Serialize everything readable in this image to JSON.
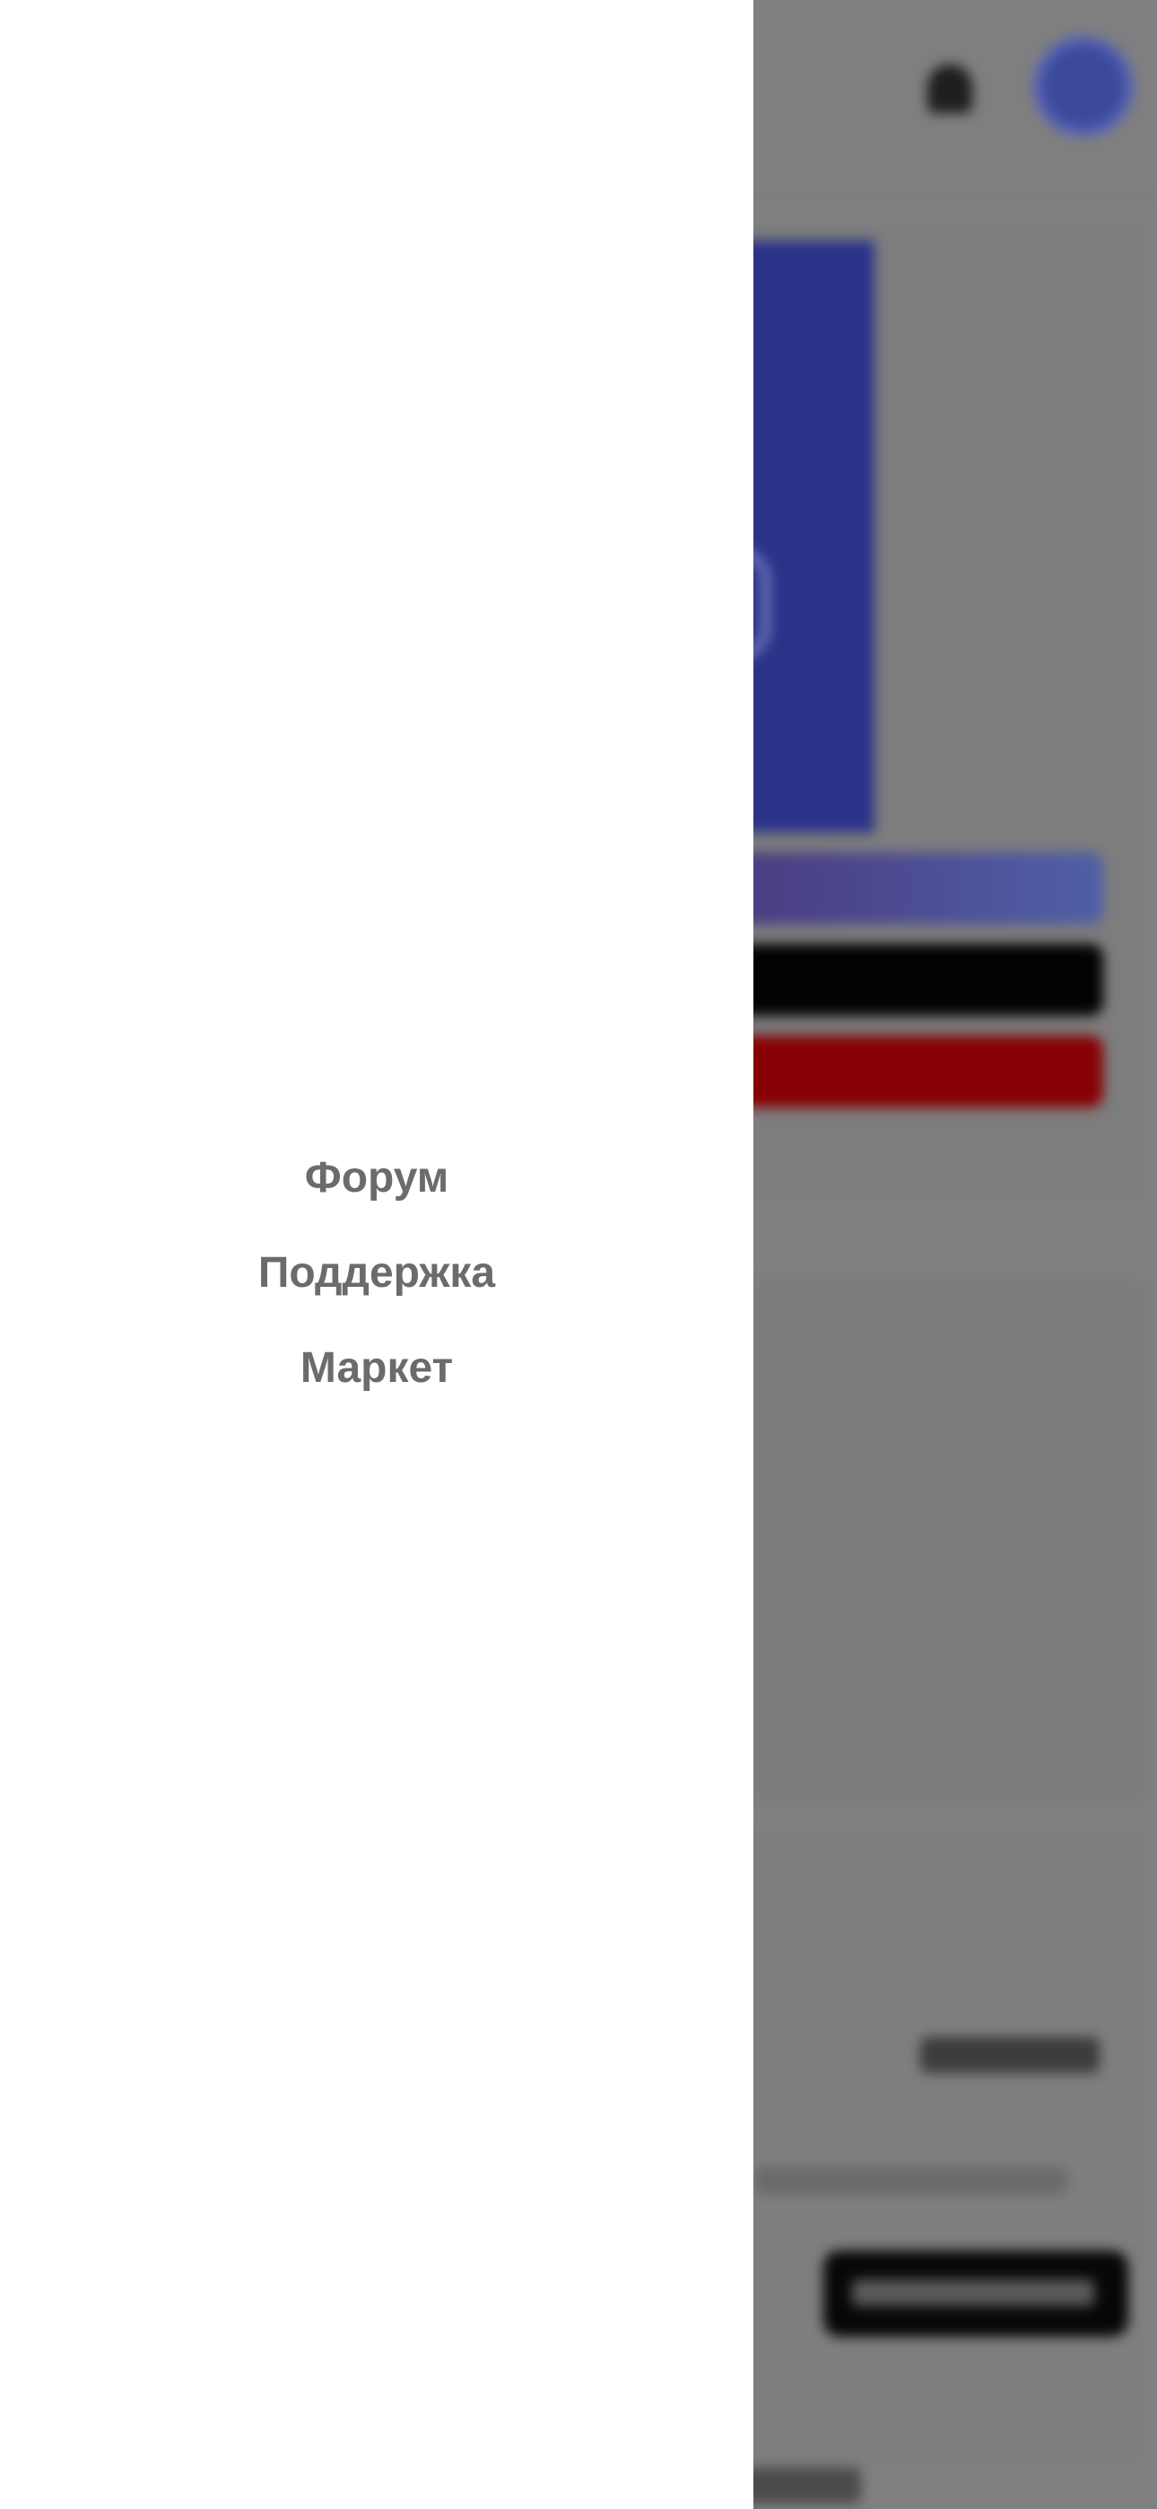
{
  "drawer": {
    "items": [
      {
        "label": "Форум"
      },
      {
        "label": "Поддержка"
      },
      {
        "label": "Маркет"
      }
    ]
  },
  "background": {
    "avatar_initials": "",
    "overlay_color": "#808080",
    "accent_color": "#2b3389",
    "danger_color": "#870003",
    "icons": [
      "bell-icon",
      "avatar"
    ]
  }
}
